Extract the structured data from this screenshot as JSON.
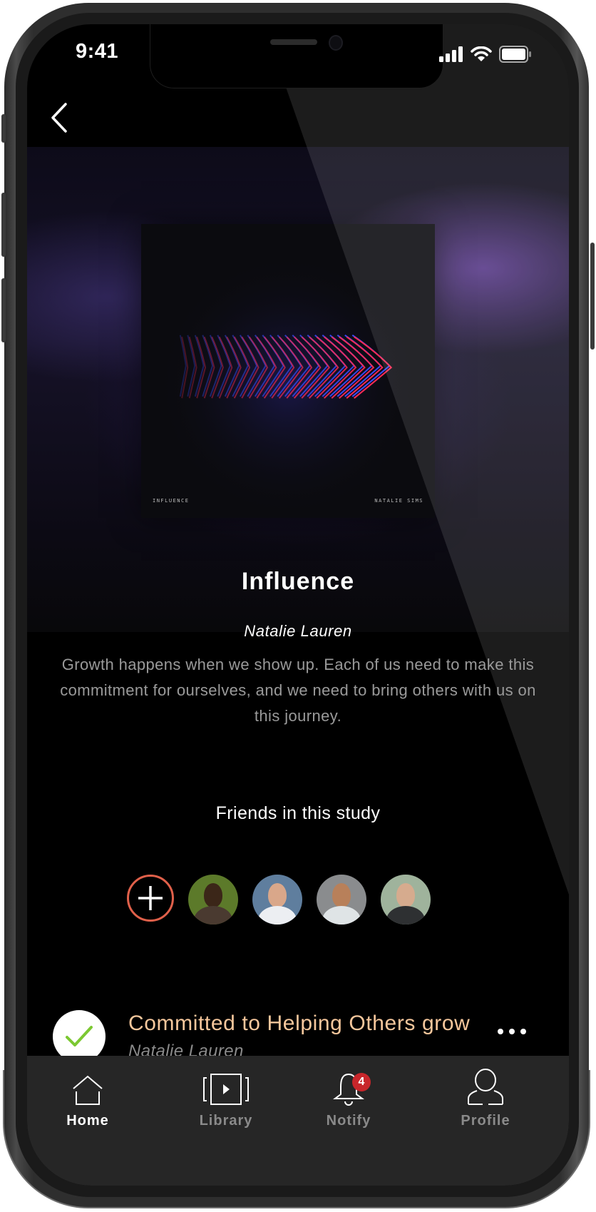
{
  "status_bar": {
    "time": "9:41",
    "icons": [
      "signal-icon",
      "wifi-icon",
      "battery-icon"
    ]
  },
  "nav": {
    "back_icon": "chevron-left-icon"
  },
  "study": {
    "cover_text_left": "INFLUENCE",
    "cover_text_right": "NATALIE SIMS",
    "title": "Influence",
    "author": "Natalie Lauren",
    "description": "Growth happens when we show up. Each of us need to make this commitment for ourselves, and we need to bring others with us on this journey."
  },
  "friends": {
    "heading": "Friends in this study",
    "add_icon": "plus-icon",
    "avatars": [
      {
        "name": "friend-1",
        "bg": "#5c7a2a",
        "skin": "#3b2618",
        "shirt": "#4a3a30"
      },
      {
        "name": "friend-2",
        "bg": "#5f7e9e",
        "skin": "#d9a78a",
        "shirt": "#eceef2"
      },
      {
        "name": "friend-3",
        "bg": "#8a8c8e",
        "skin": "#b8805a",
        "shirt": "#dfe4e6"
      },
      {
        "name": "friend-4",
        "bg": "#9fb39c",
        "skin": "#d6ab8e",
        "shirt": "#2e3032"
      }
    ]
  },
  "commitment": {
    "title": "Committed to Helping Others grow",
    "author": "Natalie Lauren",
    "status_icon": "checkmark-icon",
    "more_icon": "more-horizontal-icon"
  },
  "tabbar": {
    "tabs": [
      {
        "label": "Home",
        "icon": "home-icon",
        "active": true
      },
      {
        "label": "Library",
        "icon": "library-icon",
        "active": false
      },
      {
        "label": "Notify",
        "icon": "bell-icon",
        "active": false,
        "badge": "4"
      },
      {
        "label": "Profile",
        "icon": "profile-icon",
        "active": false
      }
    ]
  },
  "colors": {
    "accent_add": "#e0604a",
    "commit_title": "#f6c79c",
    "check_green": "#7cc832",
    "badge": "#c8262b"
  }
}
